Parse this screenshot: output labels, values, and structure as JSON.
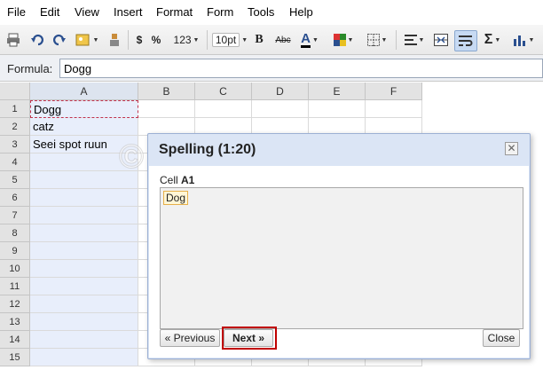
{
  "menu": [
    "File",
    "Edit",
    "View",
    "Insert",
    "Format",
    "Form",
    "Tools",
    "Help"
  ],
  "toolbar": {
    "currency": "$",
    "percent": "%",
    "number_format": "123",
    "font_size": "10pt",
    "bold": "B",
    "strike": "Abc",
    "text_color": "A",
    "sum": "Σ"
  },
  "formula": {
    "label": "Formula:",
    "value": "Dogg"
  },
  "grid": {
    "columns": [
      "A",
      "B",
      "C",
      "D",
      "E",
      "F"
    ],
    "rows": [
      "1",
      "2",
      "3",
      "4",
      "5",
      "6",
      "7",
      "8",
      "9",
      "10",
      "11",
      "12",
      "13",
      "14",
      "15"
    ],
    "cells": {
      "A1": "Dogg",
      "A2": "catz",
      "A3": "Seei spot ruun"
    }
  },
  "dialog": {
    "title": "Spelling (1:20)",
    "close_glyph": "✕",
    "cell_prefix": "Cell",
    "cell_ref": "A1",
    "suggestion": "Dog",
    "prev_label": "« Previous",
    "next_label": "Next »",
    "close_label": "Close"
  },
  "watermark": "©KS TARTS",
  "colors": {
    "accent_highlight": "#c00000",
    "dialog_bg": "#dbe5f5",
    "selected_column": "#e8eefb"
  }
}
